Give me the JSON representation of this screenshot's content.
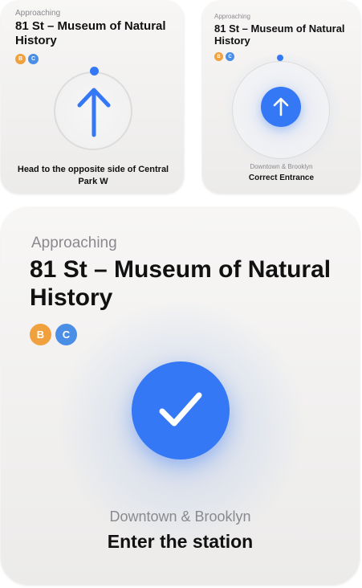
{
  "colors": {
    "accent_blue": "#3478f6",
    "line_b": "#f0a03c",
    "line_c": "#4a8ee6",
    "secondary_text": "#8a8a8e"
  },
  "widget_small_left": {
    "approaching_label": "Approaching",
    "station_name": "81 St – Museum of Natural History",
    "lines": [
      "B",
      "C"
    ],
    "direction_icon": "arrow-up-icon",
    "instruction": "Head to the opposite side of Central Park W"
  },
  "widget_small_right": {
    "approaching_label": "Approaching",
    "station_name": "81 St – Museum of Natural History",
    "lines": [
      "B",
      "C"
    ],
    "direction_icon": "arrow-up-icon",
    "direction": "Downtown & Brooklyn",
    "instruction": "Correct Entrance"
  },
  "widget_large": {
    "approaching_label": "Approaching",
    "station_name": "81 St – Museum of Natural History",
    "lines": [
      "B",
      "C"
    ],
    "status_icon": "checkmark-icon",
    "direction": "Downtown & Brooklyn",
    "instruction": "Enter the station"
  }
}
